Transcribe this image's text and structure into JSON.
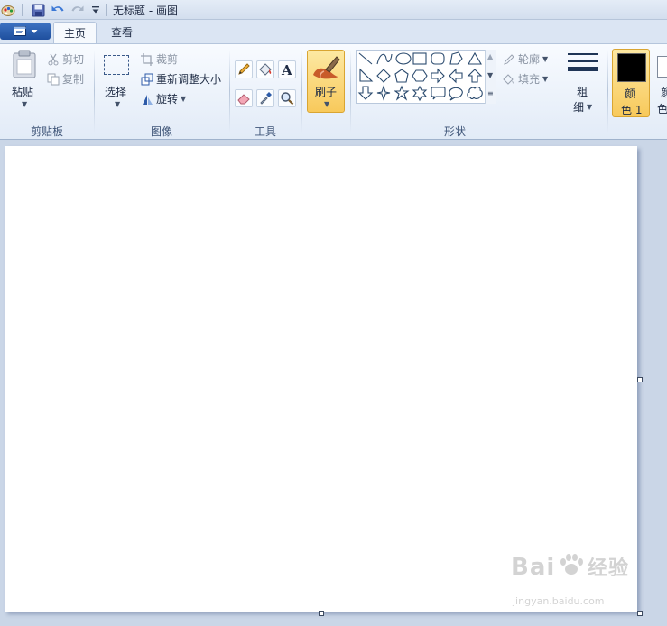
{
  "window": {
    "title": "无标题 - 画图"
  },
  "tabs": [
    {
      "label": "主页",
      "active": true
    },
    {
      "label": "查看",
      "active": false
    }
  ],
  "ribbon": {
    "clipboard": {
      "group_label": "剪贴板",
      "paste": "粘贴",
      "cut": "剪切",
      "copy": "复制"
    },
    "image": {
      "group_label": "图像",
      "select": "选择",
      "crop": "裁剪",
      "resize": "重新调整大小",
      "rotate": "旋转"
    },
    "tools": {
      "group_label": "工具"
    },
    "brushes": {
      "label": "刷子"
    },
    "shapes": {
      "group_label": "形状",
      "outline": "轮廓",
      "fill": "填充"
    },
    "size": {
      "line1": "粗",
      "line2": "细"
    },
    "colors": {
      "color1_line1": "颜",
      "color1_line2": "色 1",
      "color2_line1": "颜",
      "color2_line2": "色"
    }
  },
  "watermark": {
    "logo": "Bai",
    "logo2": "经验",
    "url": "jingyan.baidu.com"
  },
  "colors": {
    "accent": "#f8c95b",
    "canvas": "#ffffff",
    "workspace": "#cad6e7",
    "color1": "#000000",
    "color2": "#ffffff"
  }
}
